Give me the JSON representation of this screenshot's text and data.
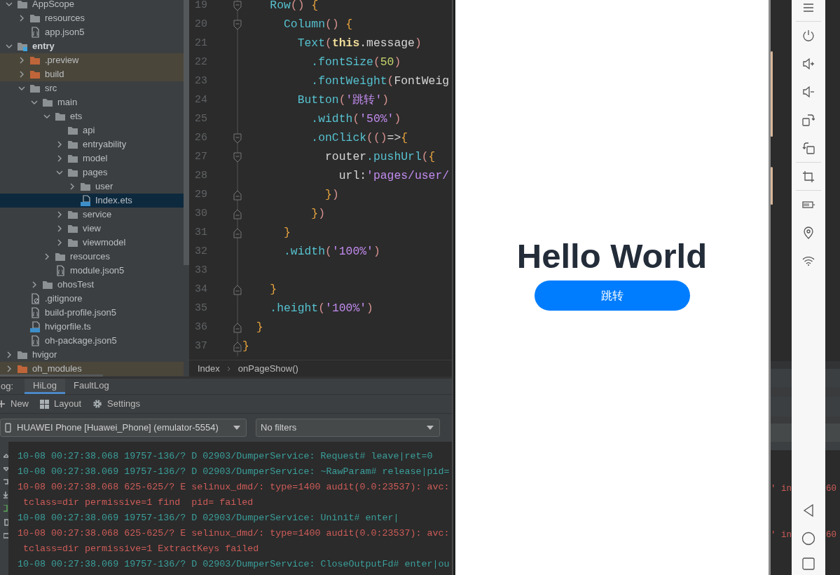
{
  "project_tree": {
    "items": [
      {
        "name": "AppScope",
        "kind": "folder",
        "expanded": true,
        "selected": false,
        "excluded": false,
        "children": [
          {
            "name": "resources",
            "kind": "folder",
            "expanded": false,
            "selected": false,
            "excluded": false
          },
          {
            "name": "app.json5",
            "kind": "json",
            "selected": false,
            "excluded": false
          }
        ]
      },
      {
        "name": "entry",
        "kind": "module",
        "expanded": true,
        "selected": false,
        "excluded": false,
        "children": [
          {
            "name": ".preview",
            "kind": "folder",
            "expanded": false,
            "selected": false,
            "excluded": true
          },
          {
            "name": "build",
            "kind": "folder",
            "expanded": false,
            "selected": false,
            "excluded": true
          },
          {
            "name": "src",
            "kind": "folder",
            "expanded": true,
            "selected": false,
            "excluded": false,
            "children": [
              {
                "name": "main",
                "kind": "folder",
                "expanded": true,
                "selected": false,
                "excluded": false,
                "children": [
                  {
                    "name": "ets",
                    "kind": "folder",
                    "expanded": true,
                    "selected": false,
                    "excluded": false,
                    "children": [
                      {
                        "name": "api",
                        "kind": "folder",
                        "selected": false,
                        "excluded": false
                      },
                      {
                        "name": "entryability",
                        "kind": "folder",
                        "expanded": false,
                        "selected": false,
                        "excluded": false
                      },
                      {
                        "name": "model",
                        "kind": "folder",
                        "expanded": false,
                        "selected": false,
                        "excluded": false
                      },
                      {
                        "name": "pages",
                        "kind": "folder",
                        "expanded": true,
                        "selected": false,
                        "excluded": false,
                        "children": [
                          {
                            "name": "user",
                            "kind": "folder",
                            "expanded": false,
                            "selected": false,
                            "excluded": false
                          },
                          {
                            "name": "Index.ets",
                            "kind": "ets",
                            "selected": true,
                            "excluded": false
                          }
                        ]
                      },
                      {
                        "name": "service",
                        "kind": "folder",
                        "expanded": false,
                        "selected": false,
                        "excluded": false
                      },
                      {
                        "name": "view",
                        "kind": "folder",
                        "expanded": false,
                        "selected": false,
                        "excluded": false
                      },
                      {
                        "name": "viewmodel",
                        "kind": "folder",
                        "expanded": false,
                        "selected": false,
                        "excluded": false
                      }
                    ]
                  },
                  {
                    "name": "resources",
                    "kind": "folder",
                    "expanded": false,
                    "selected": false,
                    "excluded": false
                  },
                  {
                    "name": "module.json5",
                    "kind": "json",
                    "selected": false,
                    "excluded": false
                  }
                ]
              },
              {
                "name": "ohosTest",
                "kind": "folder",
                "expanded": false,
                "selected": false,
                "excluded": false
              }
            ]
          },
          {
            "name": ".gitignore",
            "kind": "ignore",
            "selected": false,
            "excluded": false
          },
          {
            "name": "build-profile.json5",
            "kind": "json",
            "selected": false,
            "excluded": false
          },
          {
            "name": "hvigorfile.ts",
            "kind": "ts",
            "selected": false,
            "excluded": false
          },
          {
            "name": "oh-package.json5",
            "kind": "json",
            "selected": false,
            "excluded": false
          }
        ]
      },
      {
        "name": "hvigor",
        "kind": "folder",
        "expanded": false,
        "selected": false,
        "excluded": false
      },
      {
        "name": "oh_modules",
        "kind": "folder",
        "expanded": false,
        "selected": false,
        "excluded": true
      }
    ]
  },
  "editor": {
    "lines": [
      {
        "number": "19",
        "fold_start": true,
        "fold_end": false,
        "tokens": [
          {
            "text": "    Row",
            "kind": "fn"
          },
          {
            "text": "()",
            "kind": "paren"
          },
          {
            "text": " {",
            "kind": "brace"
          }
        ]
      },
      {
        "number": "20",
        "fold_start": true,
        "fold_end": false,
        "tokens": [
          {
            "text": "      Column",
            "kind": "fn"
          },
          {
            "text": "()",
            "kind": "paren"
          },
          {
            "text": " {",
            "kind": "brace"
          }
        ]
      },
      {
        "number": "21",
        "fold_start": false,
        "fold_end": false,
        "tokens": [
          {
            "text": "        Text",
            "kind": "fn"
          },
          {
            "text": "(",
            "kind": "paren"
          },
          {
            "text": "this",
            "kind": "keyword"
          },
          {
            "text": ".message",
            "kind": "plain"
          },
          {
            "text": ")",
            "kind": "paren"
          }
        ]
      },
      {
        "number": "22",
        "fold_start": false,
        "fold_end": false,
        "tokens": [
          {
            "text": "          .fontSize",
            "kind": "fn"
          },
          {
            "text": "(",
            "kind": "paren"
          },
          {
            "text": "50",
            "kind": "num"
          },
          {
            "text": ")",
            "kind": "paren"
          }
        ]
      },
      {
        "number": "23",
        "fold_start": false,
        "fold_end": false,
        "tokens": [
          {
            "text": "          .fontWeight",
            "kind": "fn"
          },
          {
            "text": "(",
            "kind": "paren"
          },
          {
            "text": "FontWeig",
            "kind": "plain"
          }
        ]
      },
      {
        "number": "24",
        "fold_start": false,
        "fold_end": false,
        "tokens": [
          {
            "text": "        Button",
            "kind": "fn"
          },
          {
            "text": "(",
            "kind": "paren"
          },
          {
            "text": "'跳转'",
            "kind": "str"
          },
          {
            "text": ")",
            "kind": "paren"
          }
        ]
      },
      {
        "number": "25",
        "fold_start": false,
        "fold_end": false,
        "tokens": [
          {
            "text": "          .width",
            "kind": "fn"
          },
          {
            "text": "(",
            "kind": "paren"
          },
          {
            "text": "'50%'",
            "kind": "str"
          },
          {
            "text": ")",
            "kind": "paren"
          }
        ]
      },
      {
        "number": "26",
        "fold_start": true,
        "fold_end": false,
        "tokens": [
          {
            "text": "          .onClick",
            "kind": "fn"
          },
          {
            "text": "(()",
            "kind": "paren"
          },
          {
            "text": "=>",
            "kind": "plain"
          },
          {
            "text": "{",
            "kind": "brace"
          }
        ]
      },
      {
        "number": "27",
        "fold_start": true,
        "fold_end": false,
        "tokens": [
          {
            "text": "            router",
            "kind": "plain"
          },
          {
            "text": ".pushUrl",
            "kind": "fn"
          },
          {
            "text": "(",
            "kind": "paren"
          },
          {
            "text": "{",
            "kind": "brace"
          }
        ]
      },
      {
        "number": "28",
        "fold_start": false,
        "fold_end": false,
        "tokens": [
          {
            "text": "              url:",
            "kind": "plain"
          },
          {
            "text": "'pages/user/",
            "kind": "str"
          }
        ]
      },
      {
        "number": "29",
        "fold_start": false,
        "fold_end": true,
        "tokens": [
          {
            "text": "            }",
            "kind": "brace"
          },
          {
            "text": ")",
            "kind": "paren"
          }
        ]
      },
      {
        "number": "30",
        "fold_start": false,
        "fold_end": true,
        "tokens": [
          {
            "text": "          }",
            "kind": "brace"
          },
          {
            "text": ")",
            "kind": "paren"
          }
        ]
      },
      {
        "number": "31",
        "fold_start": false,
        "fold_end": true,
        "tokens": [
          {
            "text": "      }",
            "kind": "brace"
          }
        ]
      },
      {
        "number": "32",
        "fold_start": false,
        "fold_end": false,
        "tokens": [
          {
            "text": "      .width",
            "kind": "fn"
          },
          {
            "text": "(",
            "kind": "paren"
          },
          {
            "text": "'100%'",
            "kind": "str"
          },
          {
            "text": ")",
            "kind": "paren"
          }
        ]
      },
      {
        "number": "33",
        "fold_start": false,
        "fold_end": false
      },
      {
        "number": "34",
        "fold_start": false,
        "fold_end": true,
        "tokens": [
          {
            "text": "    }",
            "kind": "brace"
          }
        ]
      },
      {
        "number": "35",
        "fold_start": false,
        "fold_end": false,
        "tokens": [
          {
            "text": "    .height",
            "kind": "fn"
          },
          {
            "text": "(",
            "kind": "paren"
          },
          {
            "text": "'100%'",
            "kind": "str"
          },
          {
            "text": ")",
            "kind": "paren"
          }
        ]
      },
      {
        "number": "36",
        "fold_start": false,
        "fold_end": true,
        "tokens": [
          {
            "text": "  }",
            "kind": "brace"
          }
        ]
      },
      {
        "number": "37",
        "fold_start": false,
        "fold_end": true,
        "tokens": [
          {
            "text": "}",
            "kind": "brace"
          }
        ]
      }
    ],
    "breadcrumb": [
      "Index",
      "onPageShow()"
    ]
  },
  "log_panel": {
    "label": "og:",
    "tabs": [
      {
        "label": "HiLog",
        "selected": true
      },
      {
        "label": "FaultLog",
        "selected": false
      }
    ],
    "toolbar": [
      {
        "label": "New",
        "kind": "add"
      },
      {
        "label": "Layout",
        "kind": "layout"
      },
      {
        "label": "Settings",
        "kind": "settings"
      }
    ],
    "device_select": {
      "value": "HUAWEI Phone [Huawei_Phone] (emulator-5554)"
    },
    "filter_select": {
      "value": "No filters"
    },
    "lines": [
      {
        "text": "10-08 00:27:38.068 19757-136/? D 02903/DumperService: Request# leave|ret=0",
        "error": false
      },
      {
        "text": "10-08 00:27:38.069 19757-136/? D 02903/DumperService: ~RawParam# release|pid=",
        "error": false
      },
      {
        "text": "10-08 00:27:38.068 625-625/? E selinux_dmd/: type=1400 audit(0.0:23537): avc:",
        "error": true,
        "fragments": [
          "' in",
          "60"
        ]
      },
      {
        "text": " tclass=dir permissive=1 find  pid= failed",
        "error": true
      },
      {
        "text": "10-08 00:27:38.069 19757-136/? D 02903/DumperService: Uninit# enter|",
        "error": false
      },
      {
        "text": "10-08 00:27:38.068 625-625/? E selinux_dmd/: type=1400 audit(0.0:23537): avc:",
        "error": true,
        "fragments": [
          "' in",
          "60"
        ]
      },
      {
        "text": " tclass=dir permissive=1 ExtractKeys failed",
        "error": true
      },
      {
        "text": "10-08 00:27:38.069 19757-136/? D 02903/DumperService: CloseOutputFd# enter|ou",
        "error": false
      }
    ]
  },
  "emulator": {
    "message": "Hello World",
    "button": "跳转"
  }
}
